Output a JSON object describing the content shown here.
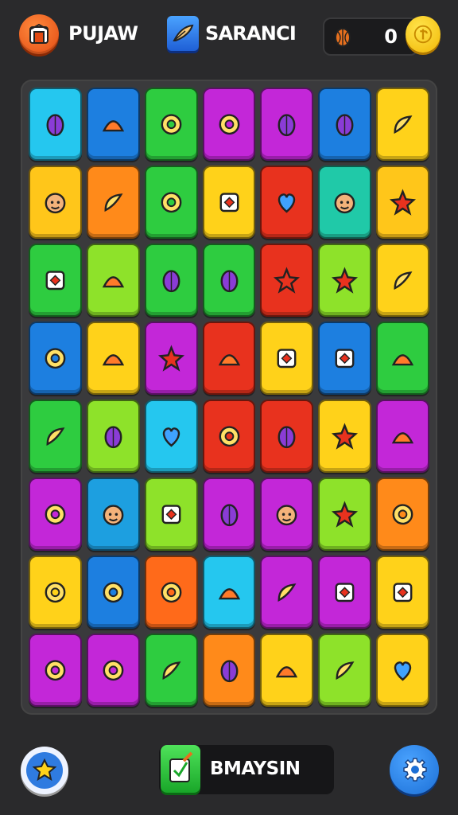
{
  "header": {
    "player_name": "PUJAW",
    "mode_name": "SARANCI",
    "coin_count": "0",
    "home_icon": "home-icon",
    "mode_icon": "feather-icon",
    "fruit_icon": "cocoa-pod-icon",
    "coin_icon": "coin-icon"
  },
  "footer": {
    "action_label": "BMAYSIN",
    "hint_icon": "star-bulb-icon",
    "action_icon": "pencil-note-icon",
    "settings_icon": "gear-icon"
  },
  "colors": {
    "background": "#2a2a2c",
    "board": "#3a3a3c",
    "accent_orange": "#e24a12",
    "accent_blue": "#1f5fd6",
    "accent_green": "#19a629",
    "coin": "#f2b705"
  },
  "tiles": [
    {
      "icon": "banana-bird-icon",
      "color": "#25c7ef"
    },
    {
      "icon": "compass-star-icon",
      "color": "#1d7fe0"
    },
    {
      "icon": "leaf-icon",
      "color": "#2ecc40"
    },
    {
      "icon": "seahorse-icon",
      "color": "#c327d8"
    },
    {
      "icon": "milk-box-icon",
      "color": "#c327d8"
    },
    {
      "icon": "rocket-ring-icon",
      "color": "#1d7fe0"
    },
    {
      "icon": "gear-star-icon",
      "color": "#ffd21a"
    },
    {
      "icon": "crate-icon",
      "color": "#ffc61a"
    },
    {
      "icon": "ring-icon",
      "color": "#ff8a1a"
    },
    {
      "icon": "pear-icon",
      "color": "#2ecc40"
    },
    {
      "icon": "eye-fish-icon",
      "color": "#ffd21a"
    },
    {
      "icon": "cheese-icon",
      "color": "#e8321e"
    },
    {
      "icon": "jar-icon",
      "color": "#20c9a8"
    },
    {
      "icon": "pepper-icon",
      "color": "#ffc61a"
    },
    {
      "icon": "sun-icon",
      "color": "#2ecc40"
    },
    {
      "icon": "candy-icon",
      "color": "#8ee22a"
    },
    {
      "icon": "peppers-icon",
      "color": "#2ecc40"
    },
    {
      "icon": "onion-icon",
      "color": "#2ecc40"
    },
    {
      "icon": "pineapple-icon",
      "color": "#e8321e"
    },
    {
      "icon": "apple-icon",
      "color": "#8ee22a"
    },
    {
      "icon": "star-box-icon",
      "color": "#ffd21a"
    },
    {
      "icon": "magnifier-icon",
      "color": "#1d7fe0"
    },
    {
      "icon": "cube-icon",
      "color": "#ffd21a"
    },
    {
      "icon": "tape-icon",
      "color": "#c327d8"
    },
    {
      "icon": "pod-icon",
      "color": "#e8321e"
    },
    {
      "icon": "face-boy-icon",
      "color": "#ffd21a"
    },
    {
      "icon": "face-girl-icon",
      "color": "#1d7fe0"
    },
    {
      "icon": "banana-icon",
      "color": "#2ecc40"
    },
    {
      "icon": "fish-icon",
      "color": "#2ecc40"
    },
    {
      "icon": "pillow-icon",
      "color": "#8ee22a"
    },
    {
      "icon": "face-bald-icon",
      "color": "#25c7ef"
    },
    {
      "icon": "bottle-icon",
      "color": "#e8321e"
    },
    {
      "icon": "face-red-icon",
      "color": "#e8321e"
    },
    {
      "icon": "squid-icon",
      "color": "#ffd21a"
    },
    {
      "icon": "shark-icon",
      "color": "#c327d8"
    },
    {
      "icon": "face-pink-icon",
      "color": "#c327d8"
    },
    {
      "icon": "box-icon",
      "color": "#1d9fe0"
    },
    {
      "icon": "tube-icon",
      "color": "#8ee22a"
    },
    {
      "icon": "moon-icon",
      "color": "#c327d8"
    },
    {
      "icon": "face-green-icon",
      "color": "#c327d8"
    },
    {
      "icon": "robot-icon",
      "color": "#8ee22a"
    },
    {
      "icon": "racket-icon",
      "color": "#ff8a1a"
    },
    {
      "icon": "tablet-icon",
      "color": "#ffd21a"
    },
    {
      "icon": "heart-icon",
      "color": "#1d7fe0"
    },
    {
      "icon": "face-cat-icon",
      "color": "#ff6a1a"
    },
    {
      "icon": "face-curly-icon",
      "color": "#25c7ef"
    },
    {
      "icon": "face-smile-icon",
      "color": "#c327d8"
    },
    {
      "icon": "face-yellow-icon",
      "color": "#c327d8"
    },
    {
      "icon": "plane-icon",
      "color": "#ffd21a"
    },
    {
      "icon": "crystal-icon",
      "color": "#c327d8"
    },
    {
      "icon": "clock-icon",
      "color": "#c327d8"
    },
    {
      "icon": "chat-icon",
      "color": "#2ecc40"
    },
    {
      "icon": "book-icon",
      "color": "#ff8a1a"
    },
    {
      "icon": "capsule-icon",
      "color": "#ffd21a"
    },
    {
      "icon": "bag-icon",
      "color": "#8ee22a"
    },
    {
      "icon": "key-icon",
      "color": "#ffd21a"
    }
  ]
}
